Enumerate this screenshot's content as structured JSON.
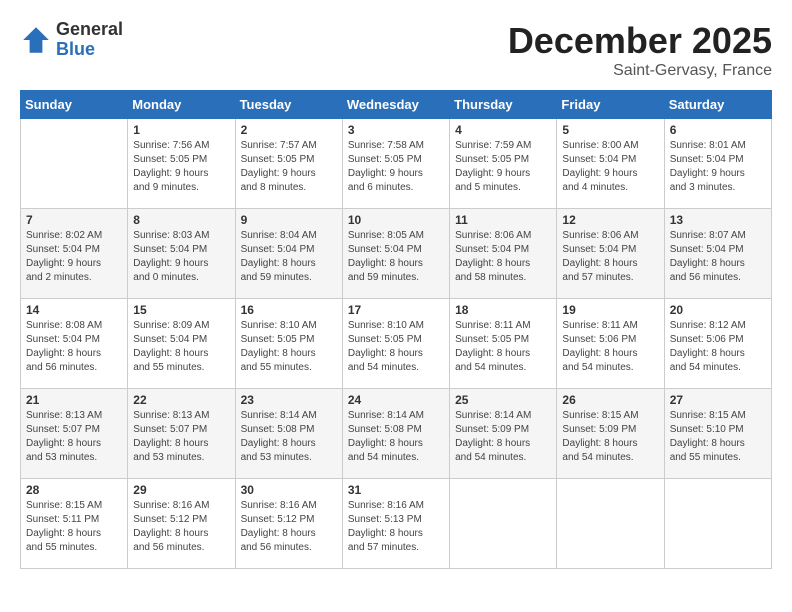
{
  "logo": {
    "general": "General",
    "blue": "Blue"
  },
  "title": "December 2025",
  "location": "Saint-Gervasy, France",
  "days_header": [
    "Sunday",
    "Monday",
    "Tuesday",
    "Wednesday",
    "Thursday",
    "Friday",
    "Saturday"
  ],
  "weeks": [
    [
      {
        "num": "",
        "info": ""
      },
      {
        "num": "1",
        "info": "Sunrise: 7:56 AM\nSunset: 5:05 PM\nDaylight: 9 hours\nand 9 minutes."
      },
      {
        "num": "2",
        "info": "Sunrise: 7:57 AM\nSunset: 5:05 PM\nDaylight: 9 hours\nand 8 minutes."
      },
      {
        "num": "3",
        "info": "Sunrise: 7:58 AM\nSunset: 5:05 PM\nDaylight: 9 hours\nand 6 minutes."
      },
      {
        "num": "4",
        "info": "Sunrise: 7:59 AM\nSunset: 5:05 PM\nDaylight: 9 hours\nand 5 minutes."
      },
      {
        "num": "5",
        "info": "Sunrise: 8:00 AM\nSunset: 5:04 PM\nDaylight: 9 hours\nand 4 minutes."
      },
      {
        "num": "6",
        "info": "Sunrise: 8:01 AM\nSunset: 5:04 PM\nDaylight: 9 hours\nand 3 minutes."
      }
    ],
    [
      {
        "num": "7",
        "info": "Sunrise: 8:02 AM\nSunset: 5:04 PM\nDaylight: 9 hours\nand 2 minutes."
      },
      {
        "num": "8",
        "info": "Sunrise: 8:03 AM\nSunset: 5:04 PM\nDaylight: 9 hours\nand 0 minutes."
      },
      {
        "num": "9",
        "info": "Sunrise: 8:04 AM\nSunset: 5:04 PM\nDaylight: 8 hours\nand 59 minutes."
      },
      {
        "num": "10",
        "info": "Sunrise: 8:05 AM\nSunset: 5:04 PM\nDaylight: 8 hours\nand 59 minutes."
      },
      {
        "num": "11",
        "info": "Sunrise: 8:06 AM\nSunset: 5:04 PM\nDaylight: 8 hours\nand 58 minutes."
      },
      {
        "num": "12",
        "info": "Sunrise: 8:06 AM\nSunset: 5:04 PM\nDaylight: 8 hours\nand 57 minutes."
      },
      {
        "num": "13",
        "info": "Sunrise: 8:07 AM\nSunset: 5:04 PM\nDaylight: 8 hours\nand 56 minutes."
      }
    ],
    [
      {
        "num": "14",
        "info": "Sunrise: 8:08 AM\nSunset: 5:04 PM\nDaylight: 8 hours\nand 56 minutes."
      },
      {
        "num": "15",
        "info": "Sunrise: 8:09 AM\nSunset: 5:04 PM\nDaylight: 8 hours\nand 55 minutes."
      },
      {
        "num": "16",
        "info": "Sunrise: 8:10 AM\nSunset: 5:05 PM\nDaylight: 8 hours\nand 55 minutes."
      },
      {
        "num": "17",
        "info": "Sunrise: 8:10 AM\nSunset: 5:05 PM\nDaylight: 8 hours\nand 54 minutes."
      },
      {
        "num": "18",
        "info": "Sunrise: 8:11 AM\nSunset: 5:05 PM\nDaylight: 8 hours\nand 54 minutes."
      },
      {
        "num": "19",
        "info": "Sunrise: 8:11 AM\nSunset: 5:06 PM\nDaylight: 8 hours\nand 54 minutes."
      },
      {
        "num": "20",
        "info": "Sunrise: 8:12 AM\nSunset: 5:06 PM\nDaylight: 8 hours\nand 54 minutes."
      }
    ],
    [
      {
        "num": "21",
        "info": "Sunrise: 8:13 AM\nSunset: 5:07 PM\nDaylight: 8 hours\nand 53 minutes."
      },
      {
        "num": "22",
        "info": "Sunrise: 8:13 AM\nSunset: 5:07 PM\nDaylight: 8 hours\nand 53 minutes."
      },
      {
        "num": "23",
        "info": "Sunrise: 8:14 AM\nSunset: 5:08 PM\nDaylight: 8 hours\nand 53 minutes."
      },
      {
        "num": "24",
        "info": "Sunrise: 8:14 AM\nSunset: 5:08 PM\nDaylight: 8 hours\nand 54 minutes."
      },
      {
        "num": "25",
        "info": "Sunrise: 8:14 AM\nSunset: 5:09 PM\nDaylight: 8 hours\nand 54 minutes."
      },
      {
        "num": "26",
        "info": "Sunrise: 8:15 AM\nSunset: 5:09 PM\nDaylight: 8 hours\nand 54 minutes."
      },
      {
        "num": "27",
        "info": "Sunrise: 8:15 AM\nSunset: 5:10 PM\nDaylight: 8 hours\nand 55 minutes."
      }
    ],
    [
      {
        "num": "28",
        "info": "Sunrise: 8:15 AM\nSunset: 5:11 PM\nDaylight: 8 hours\nand 55 minutes."
      },
      {
        "num": "29",
        "info": "Sunrise: 8:16 AM\nSunset: 5:12 PM\nDaylight: 8 hours\nand 56 minutes."
      },
      {
        "num": "30",
        "info": "Sunrise: 8:16 AM\nSunset: 5:12 PM\nDaylight: 8 hours\nand 56 minutes."
      },
      {
        "num": "31",
        "info": "Sunrise: 8:16 AM\nSunset: 5:13 PM\nDaylight: 8 hours\nand 57 minutes."
      },
      {
        "num": "",
        "info": ""
      },
      {
        "num": "",
        "info": ""
      },
      {
        "num": "",
        "info": ""
      }
    ]
  ]
}
